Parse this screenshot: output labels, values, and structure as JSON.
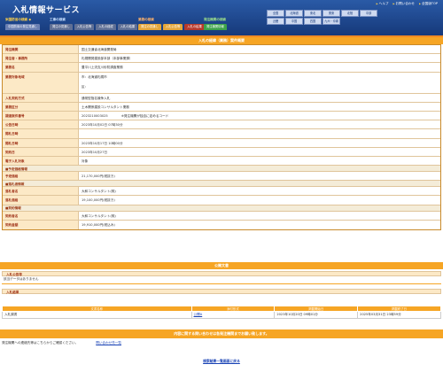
{
  "header": {
    "title": "入札情報サービス",
    "links": [
      "ヘルプ",
      "お問い合わせ",
      "全国版TOP"
    ],
    "regions": [
      "全国",
      "北海道",
      "東北",
      "関東",
      "北陸",
      "中部",
      "近畿",
      "中国",
      "四国",
      "九州・沖縄"
    ]
  },
  "nav": {
    "navy": {
      "title": "米国防省の検索 ◆",
      "tabs": [
        "中国防省の発注見通し"
      ]
    },
    "gov": {
      "title": "工事の検索",
      "tabs": [
        "発注の見通し",
        "入札公告等",
        "入札の経緯",
        "入札の結果"
      ]
    },
    "pref": {
      "title": "業務の検索",
      "tabs": [
        "発注の見通し",
        "入札公告等",
        "入札の結果"
      ]
    },
    "muni": {
      "title": "発注機関の検索",
      "tabs": [
        "発注機関情報"
      ]
    }
  },
  "main_title": "入札の経緯（業務）案件概要",
  "details": [
    {
      "label": "発注機関",
      "value": "国土交通省北海道開発局"
    },
    {
      "label": "発注者・事務所",
      "value": "札幌開発建設部本部（本部事業課）"
    },
    {
      "label": "業務名",
      "value": "豊平川上流支川砂防調査業務"
    },
    {
      "label": "業務対象地域",
      "value": "市：北海道札幌市",
      "value2": "区："
    },
    {
      "label": "入札契約方式",
      "value": "通常型指名競争入札"
    },
    {
      "label": "業務区分",
      "value": "土木関係建設コンサルタント業務"
    },
    {
      "label": "調達案件番号",
      "value": "2023210003025",
      "note": "※発注機関が独自に定めるコード"
    },
    {
      "label": "公告日時",
      "value": "2023年10月02日 07時30分"
    },
    {
      "label": "開札日時",
      "value": ""
    },
    {
      "label": "開札日時",
      "value": "2023年10月17日 10時00分"
    },
    {
      "label": "契約日",
      "value": "2023年10月27日"
    },
    {
      "label": "電子入札対象",
      "value": "対象"
    }
  ],
  "price_section": "■予定価格情報",
  "price": {
    "label": "予定価格",
    "value": "21,170,000円(税抜き)"
  },
  "fixed_section": "■落札者情報",
  "fixed": [
    {
      "label": "落札者名",
      "value": "大和コンサルタント(株)"
    },
    {
      "label": "落札価格",
      "value": "19,100,000円(税抜き)"
    }
  ],
  "contract_section": "■契約情報",
  "contract": [
    {
      "label": "契約者名",
      "value": "大和コンサルタント(株)"
    },
    {
      "label": "契約金額",
      "value": "19,910,000円(税込み)"
    }
  ],
  "notice_title": "公開文書",
  "notice": {
    "head": "入札公告等",
    "body": "該当データはありません"
  },
  "result": {
    "head": "入札結果",
    "columns": [
      "文書名称",
      "添付形式",
      "掲載開始日",
      "掲載終了日"
    ],
    "rows": [
      {
        "name": "入札調書",
        "format": "公開A",
        "start": "2023年10月20日 09時01分",
        "end": "2025年03月31日 23時59分"
      }
    ]
  },
  "contact": {
    "title": "内容に関する問い合わせは各発注機関までお願い致します。",
    "label": "発注機関への連絡先等はこちらからご確認ください。",
    "link": "問い合わせ先一覧"
  },
  "back_link": "検索結果一覧画面に戻る"
}
